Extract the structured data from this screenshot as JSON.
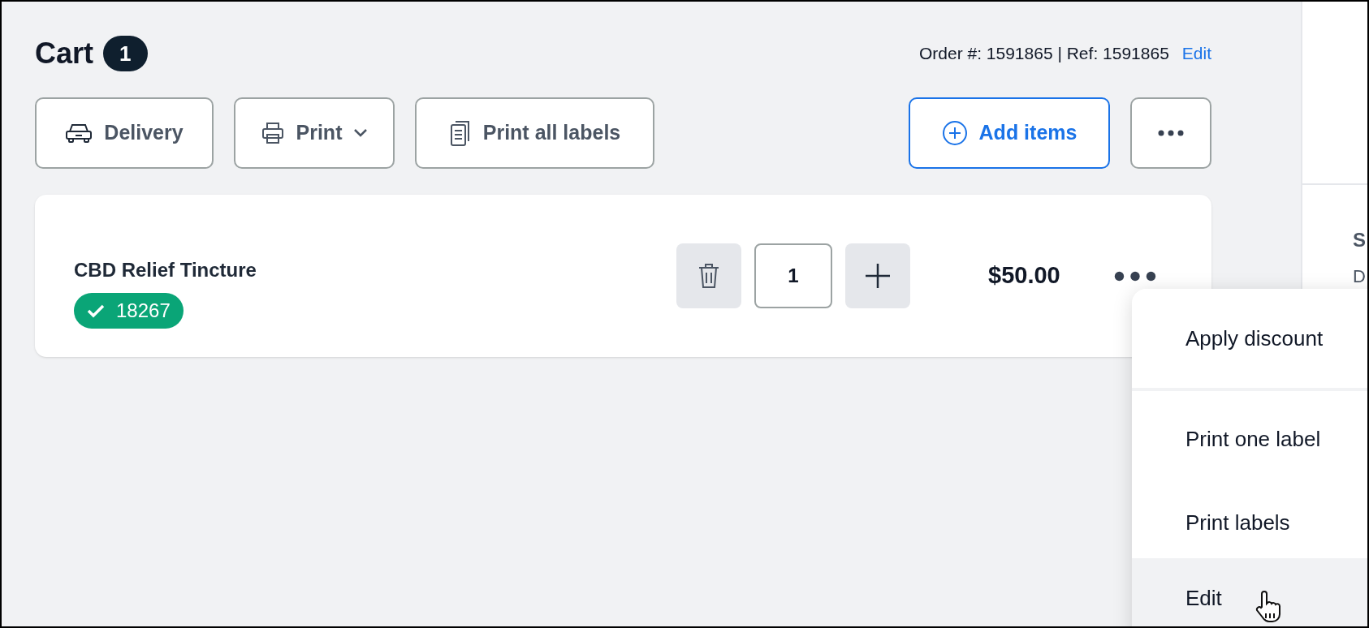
{
  "cart": {
    "title": "Cart",
    "count": "1",
    "order_info": "Order #: 1591865 | Ref: 1591865",
    "edit_link": "Edit"
  },
  "toolbar": [
    {
      "kind": "delivery",
      "label": "Delivery"
    },
    {
      "kind": "print",
      "label": "Print"
    },
    {
      "kind": "labels",
      "label": "Print all labels"
    },
    {
      "kind": "add",
      "label": "Add items"
    },
    {
      "kind": "more"
    }
  ],
  "items": [
    {
      "name": "CBD Relief Tincture",
      "tag": "18267",
      "quantity": "1",
      "price": "$50.00"
    }
  ],
  "menu": [
    {
      "label": "Apply discount",
      "selected": false,
      "divider_after": true
    },
    {
      "label": "Print one label",
      "selected": false,
      "divider_after": false
    },
    {
      "label": "Print labels",
      "selected": false,
      "divider_after": false
    },
    {
      "label": "Edit",
      "selected": true,
      "divider_after": false
    }
  ],
  "side_panel": {
    "heading": "S",
    "line": "D"
  }
}
